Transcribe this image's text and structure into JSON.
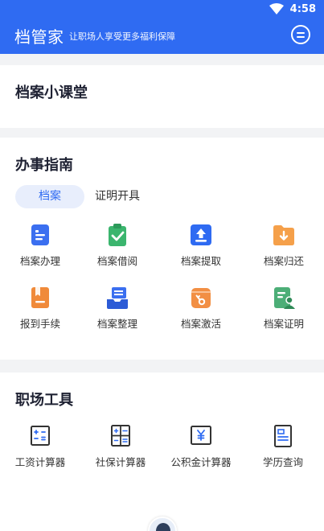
{
  "status_bar": {
    "time": "4:58"
  },
  "header": {
    "title": "档管家",
    "subtitle": "让职场人享受更多福利保障"
  },
  "classroom": {
    "title": "档案小课堂"
  },
  "guide": {
    "title": "办事指南",
    "tabs": [
      {
        "label": "档案",
        "active": true
      },
      {
        "label": "证明开具",
        "active": false
      }
    ],
    "items": [
      {
        "label": "档案办理",
        "icon": "file-document-icon",
        "color": "#3b6ff0"
      },
      {
        "label": "档案借阅",
        "icon": "clipboard-check-icon",
        "color": "#3bb56e"
      },
      {
        "label": "档案提取",
        "icon": "upload-icon",
        "color": "#2f6bf2"
      },
      {
        "label": "档案归还",
        "icon": "folder-download-icon",
        "color": "#f29a3d"
      },
      {
        "label": "报到手续",
        "icon": "bookmark-document-icon",
        "color": "#f08a3a"
      },
      {
        "label": "档案整理",
        "icon": "stack-inbox-icon",
        "color": "#3b6ff0"
      },
      {
        "label": "档案激活",
        "icon": "key-bag-icon",
        "color": "#f28f44"
      },
      {
        "label": "档案证明",
        "icon": "certificate-user-icon",
        "color": "#4cae77"
      }
    ]
  },
  "tools": {
    "title": "职场工具",
    "items": [
      {
        "label": "工资计算器",
        "icon": "calculator-icon"
      },
      {
        "label": "社保计算器",
        "icon": "social-security-calculator-icon"
      },
      {
        "label": "公积金计算器",
        "icon": "yuan-calculator-icon"
      },
      {
        "label": "学历查询",
        "icon": "education-document-icon"
      }
    ]
  }
}
